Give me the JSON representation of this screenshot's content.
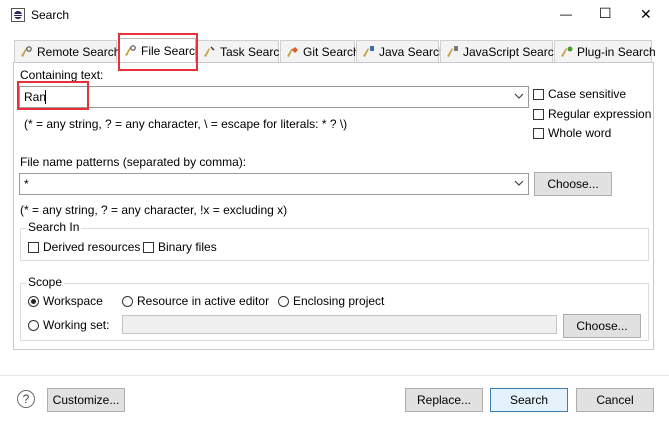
{
  "window": {
    "title": "Search",
    "controls": {
      "minimize": "—",
      "maximize": "☐",
      "close": "✕"
    }
  },
  "tabs": [
    {
      "label": "Remote Search",
      "icon": "remote-search-icon"
    },
    {
      "label": "File Search",
      "icon": "file-search-icon",
      "active": true
    },
    {
      "label": "Task Search",
      "icon": "task-search-icon"
    },
    {
      "label": "Git Search",
      "icon": "git-search-icon"
    },
    {
      "label": "Java Search",
      "icon": "java-search-icon"
    },
    {
      "label": "JavaScript Search",
      "icon": "javascript-search-icon"
    },
    {
      "label": "Plug-in Search",
      "icon": "plugin-search-icon"
    }
  ],
  "containing": {
    "label": "Containing text:",
    "value": "Ran",
    "hint": "(* = any string, ? = any character, \\ = escape for literals: * ? \\)"
  },
  "options": {
    "case_sensitive": "Case sensitive",
    "regular_expression": "Regular expression",
    "whole_word": "Whole word"
  },
  "patterns": {
    "label": "File name patterns (separated by comma):",
    "value": "*",
    "choose": "Choose...",
    "hint": "(* = any string, ? = any character, !x = excluding x)"
  },
  "search_in": {
    "label": "Search In",
    "derived": "Derived resources",
    "binary": "Binary files"
  },
  "scope": {
    "label": "Scope",
    "workspace": "Workspace",
    "active_editor": "Resource in active editor",
    "enclosing": "Enclosing project",
    "working_set": "Working set:",
    "choose": "Choose..."
  },
  "footer": {
    "help": "?",
    "customize": "Customize...",
    "replace": "Replace...",
    "search": "Search",
    "cancel": "Cancel"
  },
  "colors": {
    "highlight": "#e8303a",
    "accent": "#3c7fb1"
  }
}
